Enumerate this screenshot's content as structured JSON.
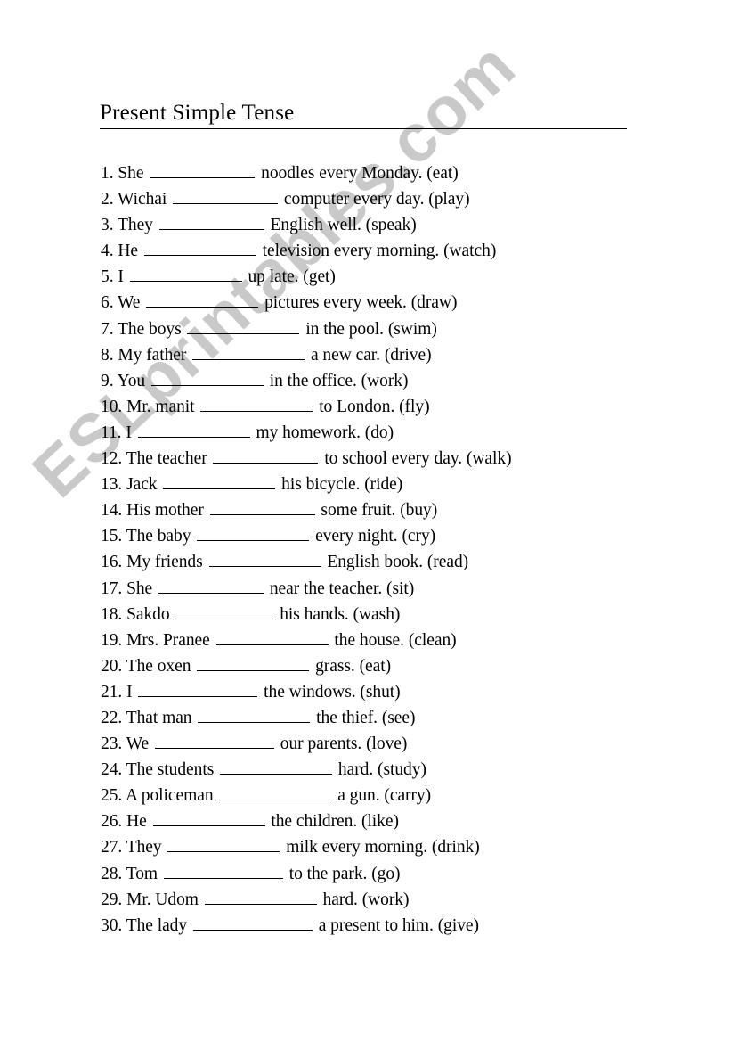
{
  "document": {
    "title": "Present Simple Tense",
    "watermark": "ESLprintables.com",
    "watermark_color": "#c9c9c9",
    "text_color": "#000000",
    "background_color": "#ffffff"
  },
  "exercises": [
    {
      "number": "1.",
      "before": "She",
      "after": "noodles every Monday.",
      "verb": "(eat)",
      "blank_width": 118
    },
    {
      "number": "2.",
      "before": "Wichai",
      "after": "computer every day.",
      "verb": "(play)",
      "blank_width": 118
    },
    {
      "number": "3.",
      "before": "They",
      "after": "English well.",
      "verb": "(speak)",
      "blank_width": 118
    },
    {
      "number": "4.",
      "before": "He",
      "after": "television every morning.",
      "verb": "(watch)",
      "blank_width": 126
    },
    {
      "number": "5.",
      "before": "I",
      "after": "up late.",
      "verb": "(get)",
      "blank_width": 126
    },
    {
      "number": "6.",
      "before": "We",
      "after": "pictures every week.",
      "verb": "(draw)",
      "blank_width": 126
    },
    {
      "number": "7.",
      "before": "The boys",
      "after": "in the pool.",
      "verb": "(swim)",
      "blank_width": 126
    },
    {
      "number": "8.",
      "before": "My father",
      "after": "a new car.",
      "verb": "(drive)",
      "blank_width": 126
    },
    {
      "number": "9.",
      "before": "You",
      "after": "in the office.",
      "verb": "(work)",
      "blank_width": 126
    },
    {
      "number": "10.",
      "before": "Mr. manit",
      "after": "to London.",
      "verb": "(fly)",
      "blank_width": 126
    },
    {
      "number": "11.",
      "before": "I",
      "after": "my homework.",
      "verb": "(do)",
      "blank_width": 126
    },
    {
      "number": "12.",
      "before": "The teacher",
      "after": "to school every day.",
      "verb": "(walk)",
      "blank_width": 118
    },
    {
      "number": "13.",
      "before": "Jack",
      "after": "his bicycle.",
      "verb": "(ride)",
      "blank_width": 126
    },
    {
      "number": "14.",
      "before": "His mother",
      "after": "some fruit.",
      "verb": "(buy)",
      "blank_width": 118
    },
    {
      "number": "15.",
      "before": "The baby",
      "after": "every night.",
      "verb": "(cry)",
      "blank_width": 126
    },
    {
      "number": "16.",
      "before": "My friends",
      "after": "English book.",
      "verb": "(read)",
      "blank_width": 126
    },
    {
      "number": "17.",
      "before": "She",
      "after": "near the teacher.",
      "verb": "(sit)",
      "blank_width": 118
    },
    {
      "number": "18.",
      "before": "Sakdo",
      "after": "his hands.",
      "verb": "(wash)",
      "blank_width": 110
    },
    {
      "number": "19.",
      "before": "Mrs. Pranee",
      "after": "the house.",
      "verb": "(clean)",
      "blank_width": 126
    },
    {
      "number": "20.",
      "before": "The oxen",
      "after": "grass.",
      "verb": "(eat)",
      "blank_width": 126
    },
    {
      "number": "21.",
      "before": "I",
      "after": "the windows.",
      "verb": "(shut)",
      "blank_width": 134
    },
    {
      "number": "22.",
      "before": "That man",
      "after": "the thief.",
      "verb": "(see)",
      "blank_width": 126
    },
    {
      "number": "23.",
      "before": "We",
      "after": "our parents.",
      "verb": "(love)",
      "blank_width": 134
    },
    {
      "number": "24.",
      "before": "The students",
      "after": "hard.",
      "verb": "(study)",
      "blank_width": 126
    },
    {
      "number": "25.",
      "before": "A policeman",
      "after": "a gun.",
      "verb": "(carry)",
      "blank_width": 126
    },
    {
      "number": "26.",
      "before": "He",
      "after": "the children.",
      "verb": "(like)",
      "blank_width": 126
    },
    {
      "number": "27.",
      "before": "They",
      "after": "milk every morning.",
      "verb": "(drink)",
      "blank_width": 126
    },
    {
      "number": "28.",
      "before": "Tom",
      "after": "to the park.",
      "verb": "(go)",
      "blank_width": 134
    },
    {
      "number": "29.",
      "before": "Mr. Udom",
      "after": "hard.",
      "verb": "(work)",
      "blank_width": 126
    },
    {
      "number": "30.",
      "before": "The lady",
      "after": "a present to him.",
      "verb": "(give)",
      "blank_width": 134
    }
  ]
}
